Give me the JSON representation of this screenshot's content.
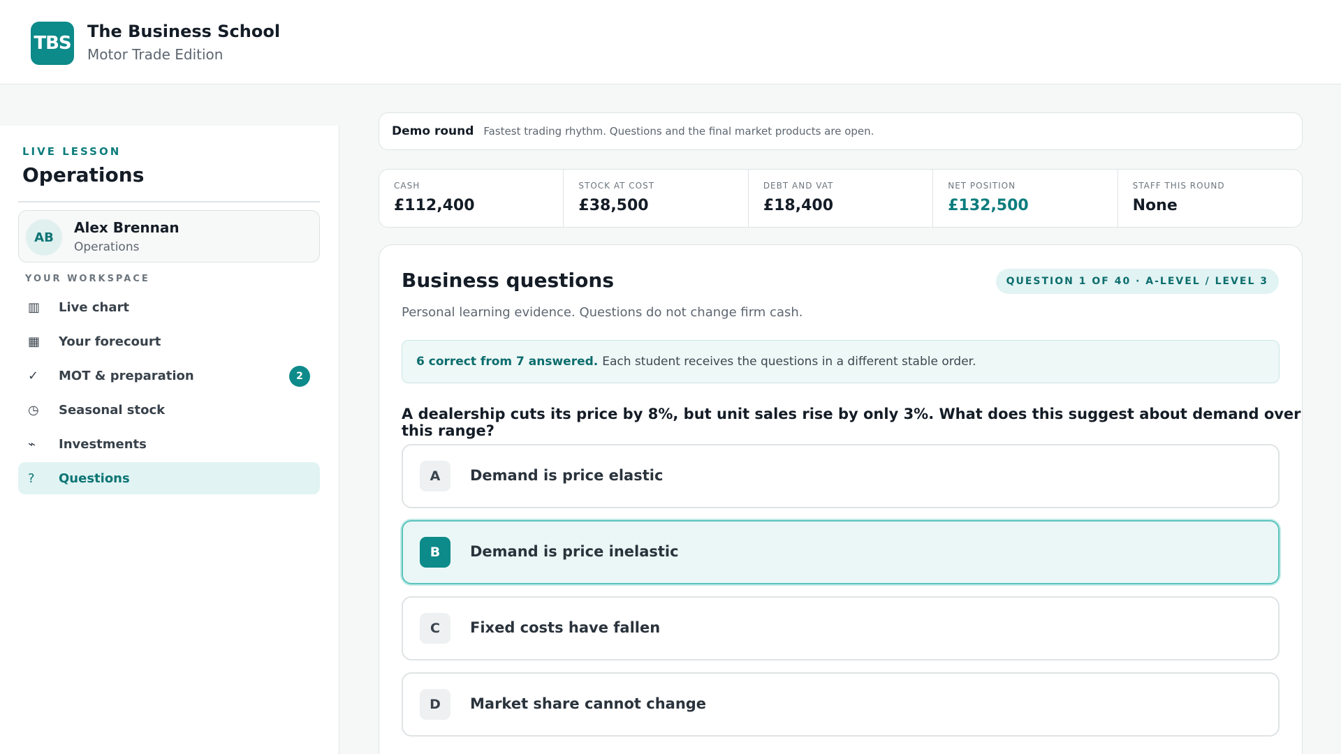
{
  "header": {
    "logo_text": "TBS",
    "title": "The Business School",
    "subtitle": "Motor Trade Edition"
  },
  "sidebar": {
    "kicker": "LIVE LESSON",
    "title": "Operations",
    "user": {
      "initials": "AB",
      "name": "Alex Brennan",
      "role": "Operations"
    },
    "workspace_label": "YOUR WORKSPACE",
    "items": [
      {
        "icon": "bar-chart-icon",
        "glyph": "▥",
        "label": "Live chart",
        "active": false
      },
      {
        "icon": "grid-icon",
        "glyph": "▦",
        "label": "Your forecourt",
        "active": false
      },
      {
        "icon": "check-icon",
        "glyph": "✓",
        "label": "MOT & preparation",
        "active": false,
        "badge": "2"
      },
      {
        "icon": "clock-icon",
        "glyph": "◷",
        "label": "Seasonal stock",
        "active": false
      },
      {
        "icon": "trend-icon",
        "glyph": "⌁",
        "label": "Investments",
        "active": false
      },
      {
        "icon": "question-icon",
        "glyph": "?",
        "label": "Questions",
        "active": true
      }
    ]
  },
  "round": {
    "name": "Demo round",
    "description": "Fastest trading rhythm. Questions and the final market products are open."
  },
  "stats": [
    {
      "label": "CASH",
      "value": "£112,400"
    },
    {
      "label": "STOCK AT COST",
      "value": "£38,500"
    },
    {
      "label": "DEBT AND VAT",
      "value": "£18,400"
    },
    {
      "label": "NET POSITION",
      "value": "£132,500",
      "accent": true
    },
    {
      "label": "STAFF THIS ROUND",
      "value": "None"
    }
  ],
  "questions_panel": {
    "title": "Business questions",
    "chip": "QUESTION 1 OF 40 · A-LEVEL / LEVEL 3",
    "subtitle": "Personal learning evidence. Questions do not change firm cash.",
    "score_strong": "6 correct from 7 answered.",
    "score_rest": "Each student receives the questions in a different stable order.",
    "question": "A dealership cuts its price by 8%, but unit sales rise by only 3%. What does this suggest about demand over this range?",
    "options": [
      {
        "letter": "A",
        "text": "Demand is price elastic",
        "selected": false
      },
      {
        "letter": "B",
        "text": "Demand is price inelastic",
        "selected": true
      },
      {
        "letter": "C",
        "text": "Fixed costs have fallen",
        "selected": false
      },
      {
        "letter": "D",
        "text": "Market share cannot change",
        "selected": false
      }
    ]
  },
  "colors": {
    "accent": "#0d8a8a",
    "accent_light": "#e1f3f3"
  }
}
